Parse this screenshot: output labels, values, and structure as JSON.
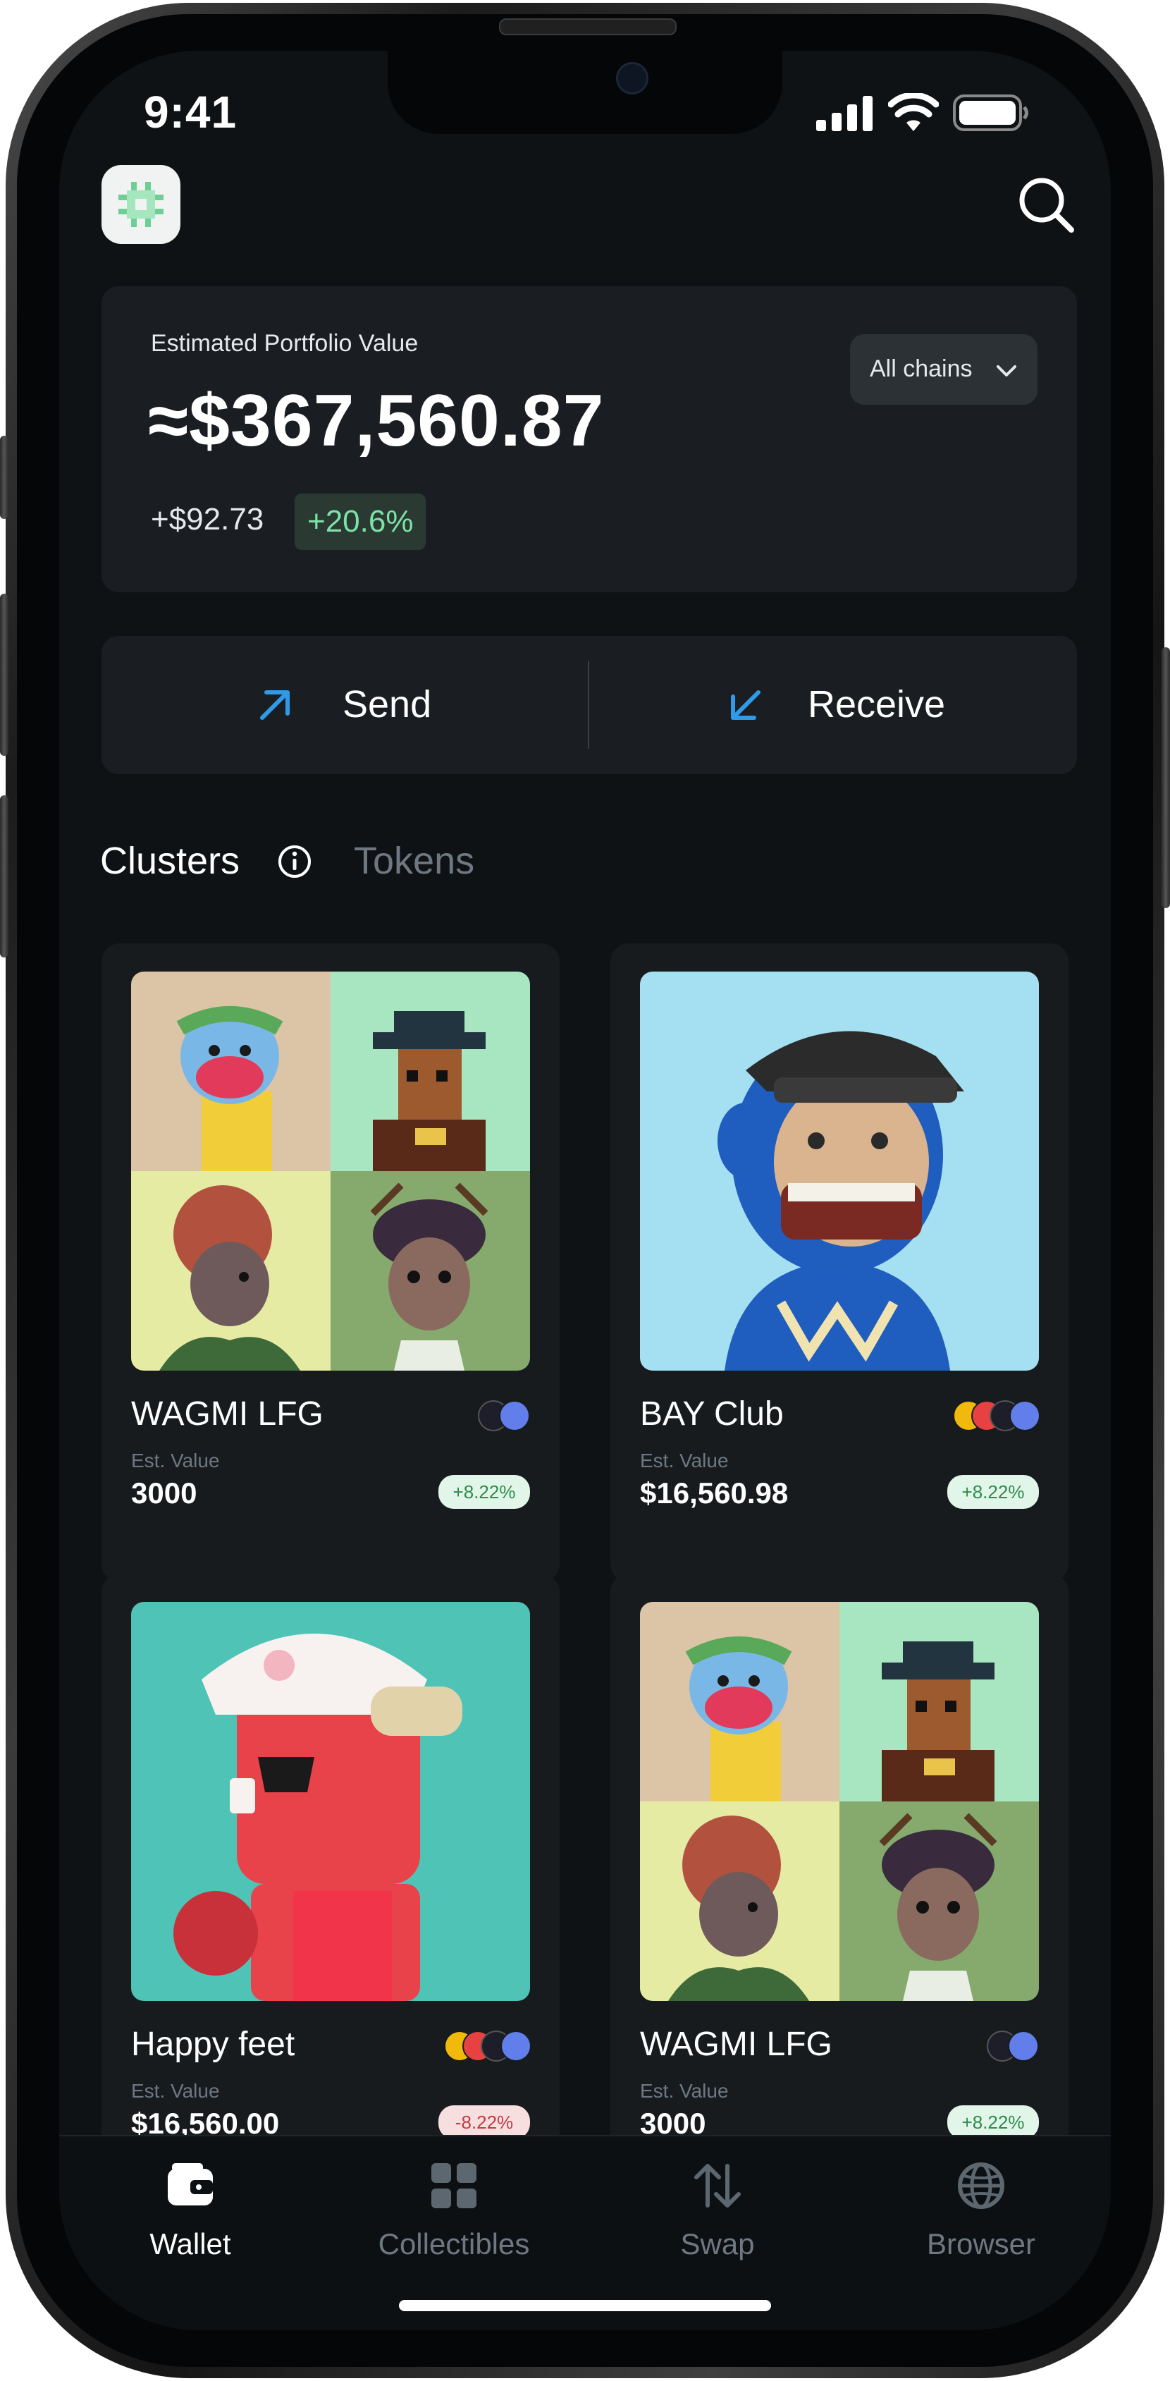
{
  "status_bar": {
    "time": "9:41"
  },
  "portfolio": {
    "label": "Estimated Portfolio Value",
    "value": "≈$367,560.87",
    "change_amount": "+$92.73",
    "change_percent": "+20.6%",
    "chain_selector": "All chains"
  },
  "actions": {
    "send": "Send",
    "receive": "Receive"
  },
  "tabs": {
    "clusters": "Clusters",
    "tokens": "Tokens"
  },
  "collections": [
    {
      "name": "WAGMI LFG",
      "value_label": "Est. Value",
      "value": "3000",
      "change": "+8.22%"
    },
    {
      "name": "BAY Club",
      "value_label": "Est. Value",
      "value": "$16,560.98",
      "change": "+8.22%"
    },
    {
      "name": "Happy feet",
      "value_label": "Est. Value",
      "value": "$16,560.00",
      "change": "-8.22%"
    },
    {
      "name": "WAGMI LFG",
      "value_label": "Est. Value",
      "value": "3000",
      "change": "+8.22%"
    }
  ],
  "bottom_nav": [
    {
      "label": "Wallet",
      "icon": "wallet-icon",
      "active": true
    },
    {
      "label": "Collectibles",
      "icon": "grid-icon",
      "active": false
    },
    {
      "label": "Swap",
      "icon": "swap-arrows-icon",
      "active": false
    },
    {
      "label": "Browser",
      "icon": "globe-icon",
      "active": false
    }
  ],
  "colors": {
    "background": "#0f1214",
    "card": "#1a1e22",
    "accent_blue": "#2f9be8",
    "positive": "#7ce2a8",
    "negative": "#c43a44"
  }
}
